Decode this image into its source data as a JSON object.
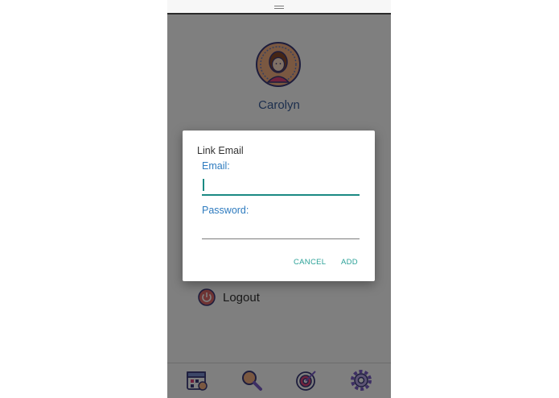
{
  "profile": {
    "name": "Carolyn"
  },
  "menu": {
    "logout_label": "Logout"
  },
  "dialog": {
    "title": "Link Email",
    "email_label": "Email:",
    "email_value": "",
    "password_label": "Password:",
    "password_value": "",
    "cancel_label": "CANCEL",
    "add_label": "ADD"
  },
  "bottom_nav": {
    "items": [
      {
        "icon": "calendar-icon"
      },
      {
        "icon": "search-icon"
      },
      {
        "icon": "target-icon"
      },
      {
        "icon": "gear-icon"
      }
    ]
  },
  "colors": {
    "accent": "#1b8a83",
    "label_blue": "#2e7bbf",
    "name_blue": "#3a5e9c"
  }
}
